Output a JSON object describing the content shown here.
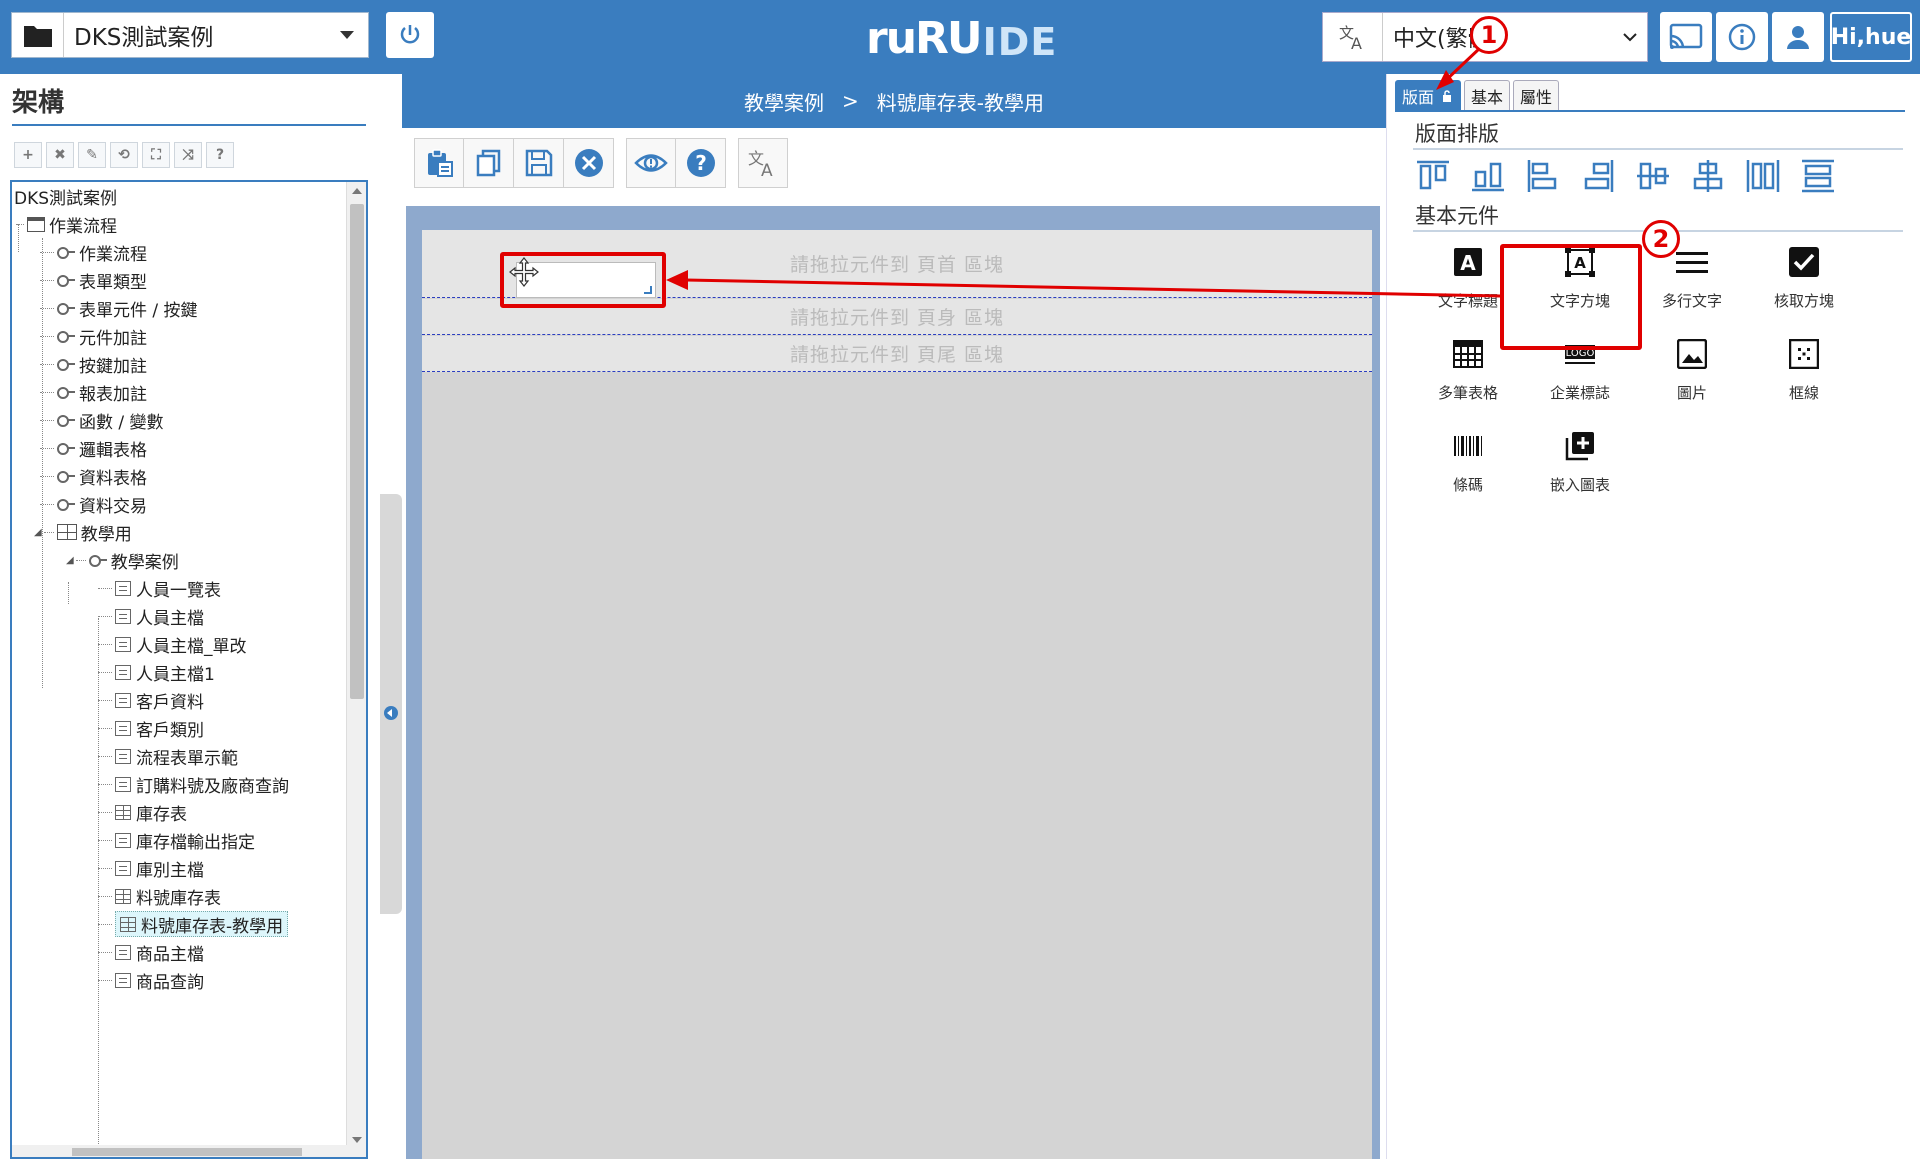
{
  "header": {
    "project_name": "DKS測試案例",
    "logo_primary": "ruRU",
    "logo_secondary": "IDE",
    "language_value": "中文(繁體)",
    "user_label": "Hi,hue"
  },
  "left_panel": {
    "title": "架構",
    "tree": {
      "root": "DKS測試案例",
      "workflow": "作業流程",
      "categories": [
        "作業流程",
        "表單類型",
        "表單元件 / 按鍵",
        "元件加註",
        "按鍵加註",
        "報表加註",
        "函數 / 變數",
        "邏輯表格",
        "資料表格",
        "資料交易"
      ],
      "teaching": "教學用",
      "teaching_case": "教學案例",
      "items": [
        {
          "label": "人員一覽表",
          "icon": "form"
        },
        {
          "label": "人員主檔",
          "icon": "form"
        },
        {
          "label": "人員主檔_單改",
          "icon": "form"
        },
        {
          "label": "人員主檔1",
          "icon": "form"
        },
        {
          "label": "客戶資料",
          "icon": "form"
        },
        {
          "label": "客戶類別",
          "icon": "form"
        },
        {
          "label": "流程表單示範",
          "icon": "form"
        },
        {
          "label": "訂購料號及廠商查詢",
          "icon": "form"
        },
        {
          "label": "庫存表",
          "icon": "grid"
        },
        {
          "label": "庫存檔輸出指定",
          "icon": "form"
        },
        {
          "label": "庫別主檔",
          "icon": "form"
        },
        {
          "label": "料號庫存表",
          "icon": "grid"
        },
        {
          "label": "料號庫存表-教學用",
          "icon": "grid"
        },
        {
          "label": "商品主檔",
          "icon": "form"
        },
        {
          "label": "商品查詢",
          "icon": "form"
        }
      ]
    }
  },
  "center": {
    "breadcrumb_parent": "教學案例",
    "breadcrumb_sep": ">",
    "breadcrumb_current": "料號庫存表-教學用",
    "band_header": "請拖拉元件到 頁首 區塊",
    "band_body": "請拖拉元件到 頁身 區塊",
    "band_footer": "請拖拉元件到 頁尾 區塊"
  },
  "right_panel": {
    "tabs": [
      "版面",
      "基本",
      "屬性"
    ],
    "active_tab": "版面",
    "layout_title": "版面排版",
    "components_title": "基本元件",
    "components": [
      "文字標題",
      "文字方塊",
      "多行文字",
      "核取方塊",
      "多筆表格",
      "企業標誌",
      "圖片",
      "框線",
      "條碼",
      "嵌入圖表"
    ],
    "logo_icon_text": "LOGO"
  },
  "annotations": {
    "marker_1": "1",
    "marker_2": "2",
    "accent": "#e00000"
  },
  "colors": {
    "brand": "#3a7dbf",
    "canvas_frame": "#8ea9cd",
    "canvas_bg": "#d4d4d4"
  }
}
